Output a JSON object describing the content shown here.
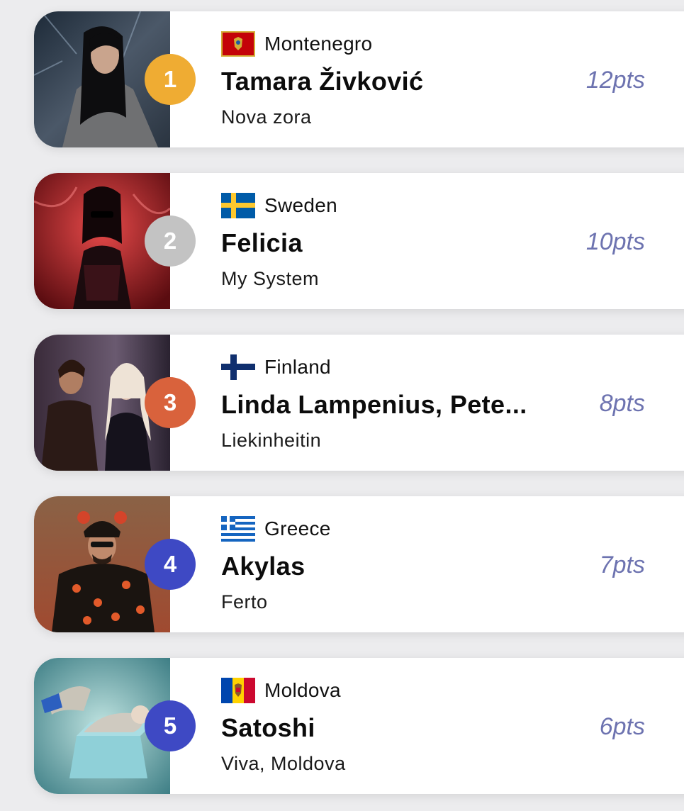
{
  "entries": [
    {
      "rank": "1",
      "rank_color": "#efac33",
      "country": "Montenegro",
      "flag": "montenegro-flag-icon",
      "artist": "Tamara Živković",
      "song": "Nova zora",
      "points": "12pts"
    },
    {
      "rank": "2",
      "rank_color": "#c3c3c3",
      "country": "Sweden",
      "flag": "sweden-flag-icon",
      "artist": "Felicia",
      "song": "My System",
      "points": "10pts"
    },
    {
      "rank": "3",
      "rank_color": "#d9623c",
      "country": "Finland",
      "flag": "finland-flag-icon",
      "artist": "Linda Lampenius, Pete...",
      "song": "Liekinheitin",
      "points": "8pts"
    },
    {
      "rank": "4",
      "rank_color": "#3e49c4",
      "country": "Greece",
      "flag": "greece-flag-icon",
      "artist": "Akylas",
      "song": "Ferto",
      "points": "7pts"
    },
    {
      "rank": "5",
      "rank_color": "#3e49c4",
      "country": "Moldova",
      "flag": "moldova-flag-icon",
      "artist": "Satoshi",
      "song": "Viva, Moldova",
      "points": "6pts"
    }
  ]
}
